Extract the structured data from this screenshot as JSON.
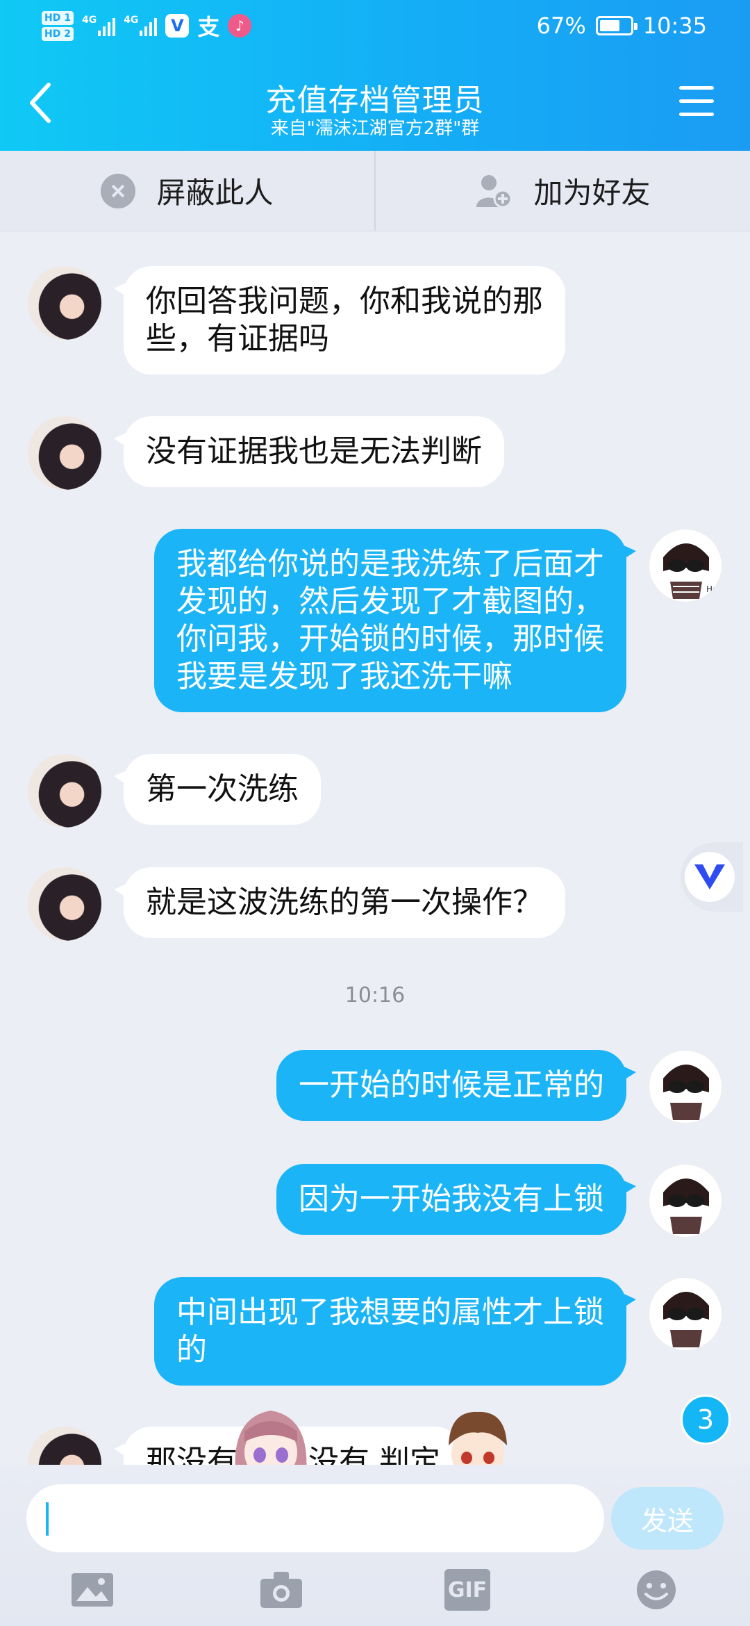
{
  "status_bar": {
    "sim1": "HD 1",
    "sim2": "HD 2",
    "net1": "4G",
    "net2": "4G",
    "zhi_glyph": "支",
    "battery_percent_text": "67%",
    "battery_level": 0.67,
    "time": "10:35"
  },
  "header": {
    "title": "充值存档管理员",
    "subtitle": "来自\"濡沫江湖官方2群\"群"
  },
  "actions": {
    "block_label": "屏蔽此人",
    "add_friend_label": "加为好友"
  },
  "messages": [
    {
      "from": "other",
      "text": "你回答我问题，你和我说的那\n些，有证据吗"
    },
    {
      "from": "other",
      "text": "没有证据我也是无法判断"
    },
    {
      "from": "me",
      "text": "我都给你说的是我洗练了后面才\n发现的，然后发现了才截图的，\n你问我，开始锁的时候，那时候\n我要是发现了我还洗干嘛"
    },
    {
      "from": "other",
      "text": "第一次洗练"
    },
    {
      "from": "other",
      "text": "就是这波洗练的第一次操作？"
    },
    {
      "from": "me",
      "text": "一开始的时候是正常的"
    },
    {
      "from": "me",
      "text": "因为一开始我没有上锁"
    },
    {
      "from": "me",
      "text": "中间出现了我想要的属性才上锁\n的"
    },
    {
      "from": "other",
      "text": "那没有      我也没有      判定"
    }
  ],
  "timestamp": "10:16",
  "unread_badge": "3",
  "input": {
    "value": "",
    "send_label": "发送"
  },
  "toolbar": {
    "gif_label": "GIF"
  },
  "colors": {
    "header_start": "#10c9f5",
    "header_end": "#1a9cf3",
    "bubble_out": "#1bb5f7",
    "bubble_in": "#ffffff",
    "background": "#eceef6"
  }
}
